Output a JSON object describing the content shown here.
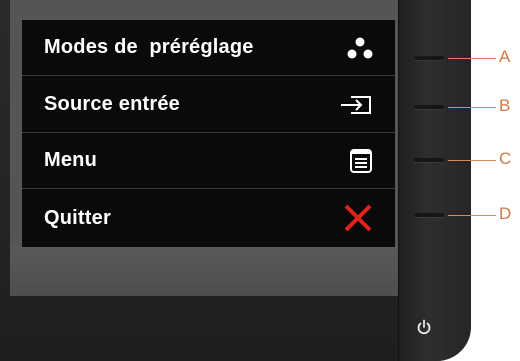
{
  "osd": {
    "items": [
      {
        "label": "Modes de  préréglage",
        "icon": "preset-modes-icon"
      },
      {
        "label": "Source entrée",
        "icon": "input-source-icon"
      },
      {
        "label": "Menu",
        "icon": "menu-icon"
      },
      {
        "label": "Quitter",
        "icon": "close-icon"
      }
    ]
  },
  "buttons": {
    "callouts": [
      "A",
      "B",
      "C",
      "D"
    ],
    "power_icon": "power-icon"
  },
  "colors": {
    "osd_background": "#0a0a0a",
    "text": "#ffffff",
    "exit_red": "#e0241b",
    "callout_orange": "#d07a48"
  }
}
